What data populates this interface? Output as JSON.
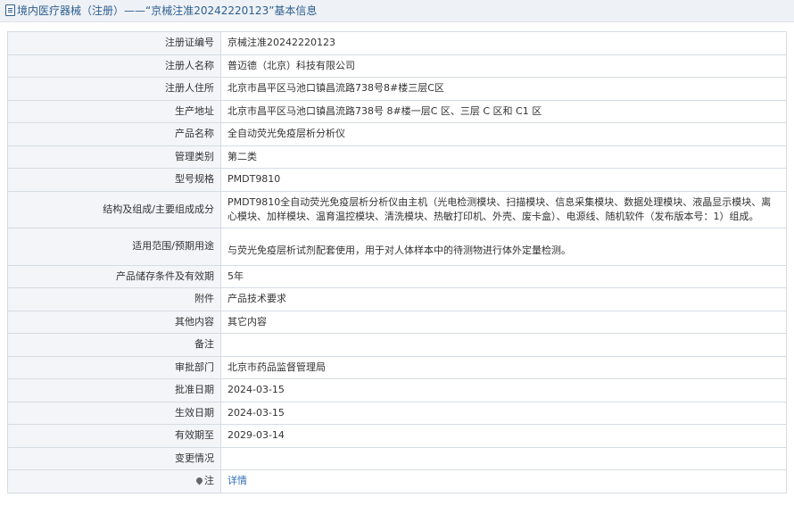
{
  "header": {
    "title": "境内医疗器械（注册）——“京械注准20242220123”基本信息"
  },
  "rows": [
    {
      "label": "注册证编号",
      "value": "京械注准20242220123"
    },
    {
      "label": "注册人名称",
      "value": "普迈德（北京）科技有限公司"
    },
    {
      "label": "注册人住所",
      "value": "北京市昌平区马池口镇昌流路738号8#楼三层C区"
    },
    {
      "label": "生产地址",
      "value": "北京市昌平区马池口镇昌流路738号 8#楼一层C 区、三层 C 区和 C1 区"
    },
    {
      "label": "产品名称",
      "value": "全自动荧光免疫层析分析仪"
    },
    {
      "label": "管理类别",
      "value": "第二类"
    },
    {
      "label": "型号规格",
      "value": "PMDT9810"
    },
    {
      "label": "结构及组成/主要组成成分",
      "value": "PMDT9810全自动荧光免疫层析分析仪由主机（光电检测模块、扫描模块、信息采集模块、数据处理模块、液晶显示模块、离心模块、加样模块、温育温控模块、清洗模块、热敏打印机、外壳、废卡盒）、电源线、随机软件（发布版本号：1）组成。"
    },
    {
      "label": "适用范围/预期用途",
      "value": "与荧光免疫层析试剂配套使用，用于对人体样本中的待测物进行体外定量检测。"
    },
    {
      "label": "产品储存条件及有效期",
      "value": "5年"
    },
    {
      "label": "附件",
      "value": "产品技术要求"
    },
    {
      "label": "其他内容",
      "value": "其它内容"
    },
    {
      "label": "备注",
      "value": ""
    },
    {
      "label": "审批部门",
      "value": "北京市药品监督管理局"
    },
    {
      "label": "批准日期",
      "value": "2024-03-15"
    },
    {
      "label": "生效日期",
      "value": "2024-03-15"
    },
    {
      "label": "有效期至",
      "value": "2029-03-14"
    },
    {
      "label": "变更情况",
      "value": ""
    }
  ],
  "note": {
    "label": "注",
    "link_text": "详情"
  }
}
